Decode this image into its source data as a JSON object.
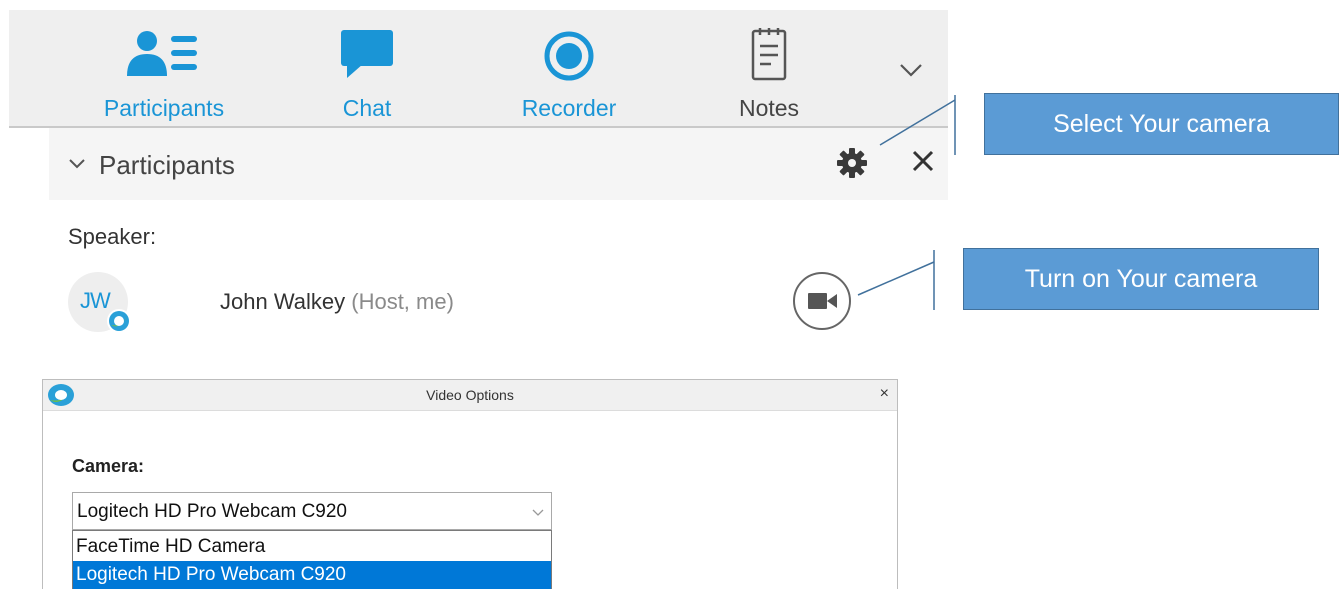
{
  "toolbar": {
    "tabs": [
      {
        "label": "Participants",
        "icon": "participants-icon"
      },
      {
        "label": "Chat",
        "icon": "chat-icon"
      },
      {
        "label": "Recorder",
        "icon": "recorder-icon"
      },
      {
        "label": "Notes",
        "icon": "notes-icon"
      }
    ],
    "more_icon": "chevron-down-icon"
  },
  "participants_panel": {
    "title": "Participants",
    "section_label": "Speaker:",
    "participant": {
      "initials": "JW",
      "name": "John Walkey",
      "role": "(Host, me)"
    }
  },
  "callouts": {
    "select_camera": "Select Your camera",
    "turn_on_camera": "Turn on Your camera"
  },
  "video_options": {
    "title": "Video Options",
    "close": "×",
    "camera_label": "Camera:",
    "selected": "Logitech HD Pro Webcam C920",
    "options": [
      "FaceTime HD Camera",
      "Logitech HD Pro Webcam C920"
    ]
  },
  "colors": {
    "accent_blue": "#1a95d6",
    "callout_blue": "#5b9bd5",
    "selection_blue": "#0078d7"
  }
}
